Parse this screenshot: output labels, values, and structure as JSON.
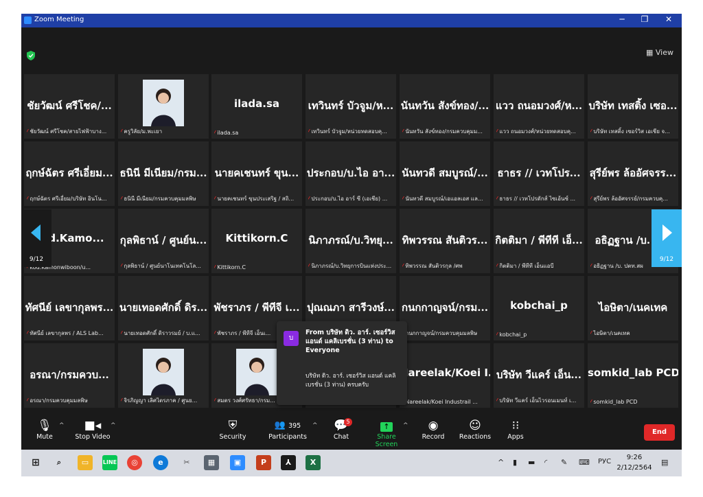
{
  "window": {
    "title": "Zoom Meeting",
    "minimize": "─",
    "restore": "❐",
    "close": "✕"
  },
  "top": {
    "view_label": "View"
  },
  "tiles": [
    {
      "name": "ชัยวัฒน์ ศรีโชค/...",
      "label": "ชัยวัฒน์ ศรีโชค/สายไฟฟ้าบาง...",
      "photo": false
    },
    {
      "name": "",
      "label": "ครูวิลัย/ม.พะเยา",
      "photo": true
    },
    {
      "name": "ilada.sa",
      "label": "ilada.sa",
      "photo": false,
      "sans": true
    },
    {
      "name": "เทวินทร์ บัวจูม/ห...",
      "label": "เทวินทร์ บัวจูม/หน่วยทดสอบคุ...",
      "photo": false
    },
    {
      "name": "นันทวัน สังข์ทอง/...",
      "label": "นันทวัน สังข์ทอง/กรมควบคุมม...",
      "photo": false
    },
    {
      "name": "แวว ถนอมวงศ์/ห...",
      "label": "แวว ถนอมวงศ์/หน่วยทดสอบคุ...",
      "photo": false
    },
    {
      "name": "บริษัท เทสติ้ง เซอ...",
      "label": "บริษัท เทสติ้ง เซอร์วิส เอเชีย จ...",
      "photo": false
    },
    {
      "name": "ฤกษ์ฉัตร ศรีเอี่ยม...",
      "label": "ฤกษ์ฉัตร ศรีเอี่ยม/บริษัท อินโน...",
      "photo": false
    },
    {
      "name": "ธนินี มีเนียม/กรม...",
      "label": "ธนินี มีเนียม/กรมควบคุมมลพิษ",
      "photo": false
    },
    {
      "name": "นายคเชนทร์ ขุน...",
      "label": "นายคเชนทร์ ขุนประเสริฐ / สถิ...",
      "photo": false
    },
    {
      "name": "ประกอบ/บ.ไอ อา...",
      "label": "ประกอบ/บ.ไอ อาร์ ซี (เอเชีย) ...",
      "photo": false
    },
    {
      "name": "นันทวดี สมบูรณ์/...",
      "label": "นันทวดี สมบูรณ์/เอแอลเอส แล...",
      "photo": false
    },
    {
      "name": "ธาธร // เวทโปร...",
      "label": "ธาธร // เวทโปรดักส์ ไซเอ้นซ์ ...",
      "photo": false
    },
    {
      "name": "สุรีย์พร ล้ออัศจรร...",
      "label": "สุรีย์พร ล้ออัศจรรย์/กรมควบคุ...",
      "photo": false
    },
    {
      "name": "kod.Kamo...",
      "label": "kod.Kamonwiboon/u...",
      "photo": false,
      "sans": true
    },
    {
      "name": "กุลพิธาน์ / ศูนย์น...",
      "label": "กุลพิธาน์ / ศูนย์นาโนเทคโนโล...",
      "photo": false
    },
    {
      "name": "Kittikorn.C",
      "label": "Kittikorn.C",
      "photo": false,
      "sans": true
    },
    {
      "name": "นิภาภรณ์/บ.วิทยุ...",
      "label": "นิภาภรณ์/บ.วิทยุการบินแห่งประ...",
      "photo": false
    },
    {
      "name": "ทิพวรรณ สันติวร...",
      "label": "ทิพวรรณ สันติวรกุล /ศพ",
      "photo": false
    },
    {
      "name": "กิตติมา / พีทีที เอ็...",
      "label": "กิตติมา / พีทีที เอ็นแอบี",
      "photo": false
    },
    {
      "name": "อธิฏฐาน /บ. ป...",
      "label": "อธิฏฐาน /บ. ปตท.สผ",
      "photo": false
    },
    {
      "name": "ทัศนีย์ เลขากุลพร...",
      "label": "ทัศนีย์ เลขากุลพร / ALS Lab...",
      "photo": false
    },
    {
      "name": "นายเทอดศักดิ์ ดิร...",
      "label": "นายเทอดศักดิ์ ดิราวรมย์ / บ.แ...",
      "photo": false
    },
    {
      "name": "พัชราภร / พีทีจี เ...",
      "label": "พัชราภร / พีทีจี เอ็นเ...",
      "photo": false
    },
    {
      "name": "ปุณณภา สารีวงษ์...",
      "label": "",
      "photo": false
    },
    {
      "name": "กนกกาญจน์/กรม...",
      "label": "กนกกาญจน์/กรมควบคุมมลพิษ",
      "photo": false
    },
    {
      "name": "kobchai_p",
      "label": "kobchai_p",
      "photo": false,
      "sans": true
    },
    {
      "name": "ไอษิตา/เนคเทค",
      "label": "ไอษิตา/เนคเทค",
      "photo": false
    },
    {
      "name": "อรณา/กรมควบ...",
      "label": "อรณา/กรมควบคุมมลพิษ",
      "photo": false
    },
    {
      "name": "",
      "label": "จิรภิญญา เลิศไตรภาค / ศูนย...",
      "photo": true
    },
    {
      "name": "",
      "label": "สมตร วงศ์ศรัทธา/กรม...",
      "photo": true
    },
    {
      "name": "",
      "label": "",
      "photo": false
    },
    {
      "name": "Nareelak/Koei I...",
      "label": "Nareelak/Koei Industrail ...",
      "photo": false,
      "sans": true
    },
    {
      "name": "บริษัท วีแคร์ เอ็น...",
      "label": "บริษัท วีแคร์ เอ็นไวรอนเมนท์ เ...",
      "photo": false
    },
    {
      "name": "somkid_lab PCD",
      "label": "somkid_lab PCD",
      "photo": false,
      "sans": true
    }
  ],
  "nav": {
    "left_page": "9/12",
    "right_page": "9/12"
  },
  "toast": {
    "avatar": "บ",
    "header": "From บริษัท ดิว. อาร์. เซอร์วิส แอนด์ แคลิเบรชั่น (3 ท่าน) to Everyone",
    "body": "บริษัท ดิว. อาร์. เซอร์วิส แอนด์ แคลิเบรชั่น (3 ท่าน) ครบครับ"
  },
  "toolbar": {
    "mute": "Mute",
    "stop_video": "Stop Video",
    "security": "Security",
    "participants": "Participants",
    "participants_count": "395",
    "chat": "Chat",
    "chat_badge": "5",
    "share_screen": "Share Screen",
    "record": "Record",
    "reactions": "Reactions",
    "apps": "Apps",
    "end": "End"
  },
  "taskbar": {
    "lang": "РУС",
    "time": "9:26",
    "date": "2/12/2564"
  },
  "colors": {
    "share_green": "#22d35a",
    "end_red": "#e02828",
    "nav_blue": "#38b6f0",
    "title_blue": "#1f3fa6"
  }
}
